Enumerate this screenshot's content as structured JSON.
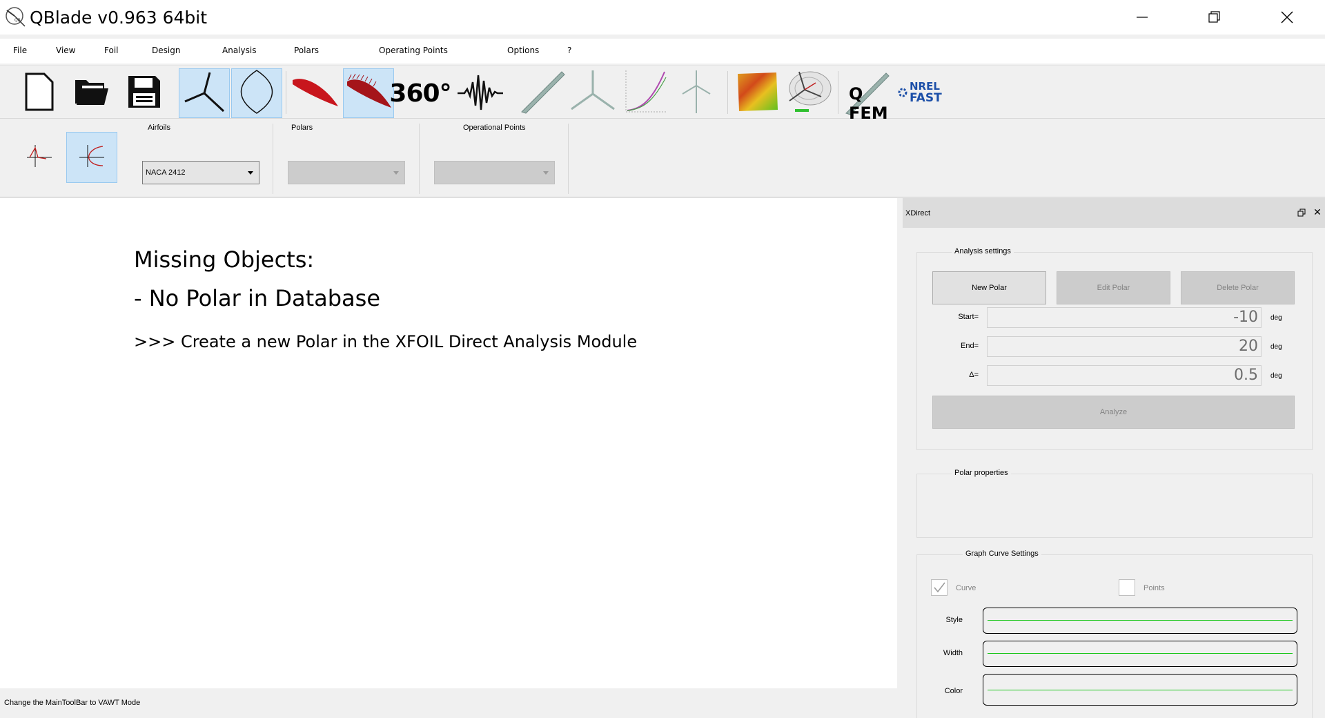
{
  "window": {
    "title": "QBlade v0.963 64bit"
  },
  "menu": [
    "File",
    "View",
    "Foil",
    "Design",
    "Analysis",
    "Polars",
    "Operating Points",
    "Options",
    "?"
  ],
  "toolbar": {
    "groups": {
      "airfoils_label": "Airfoils",
      "polars_label": "Polars",
      "oppoints_label": "Operational Points"
    },
    "airfoil_selected": "NACA 2412",
    "polars_selected": "",
    "oppoints_selected": "",
    "icon_360_label": "360°",
    "icon_qfem_label": "Q FEM",
    "icon_nrel_label1": "NREL",
    "icon_nrel_label2": "FAST"
  },
  "canvas": {
    "line1": "Missing Objects:",
    "line2": "- No Polar in Database",
    "line3": ">>> Create a new Polar in the XFOIL Direct Analysis Module"
  },
  "status": {
    "text": "Change the MainToolBar to VAWT Mode"
  },
  "dock": {
    "title": "XDirect",
    "analysis": {
      "group_title": "Analysis settings",
      "new_polar": "New Polar",
      "edit_polar": "Edit Polar",
      "delete_polar": "Delete Polar",
      "start_label": "Start=",
      "start_value": "-10",
      "end_label": "End=",
      "end_value": "20",
      "delta_label": "Δ=",
      "delta_value": "0.5",
      "unit": "deg",
      "analyze": "Analyze"
    },
    "polar_properties_title": "Polar properties",
    "graph": {
      "group_title": "Graph Curve Settings",
      "curve_label": "Curve",
      "curve_checked": true,
      "points_label": "Points",
      "points_checked": false,
      "style_label": "Style",
      "width_label": "Width",
      "color_label": "Color",
      "line_color": "#1bc61b"
    }
  }
}
